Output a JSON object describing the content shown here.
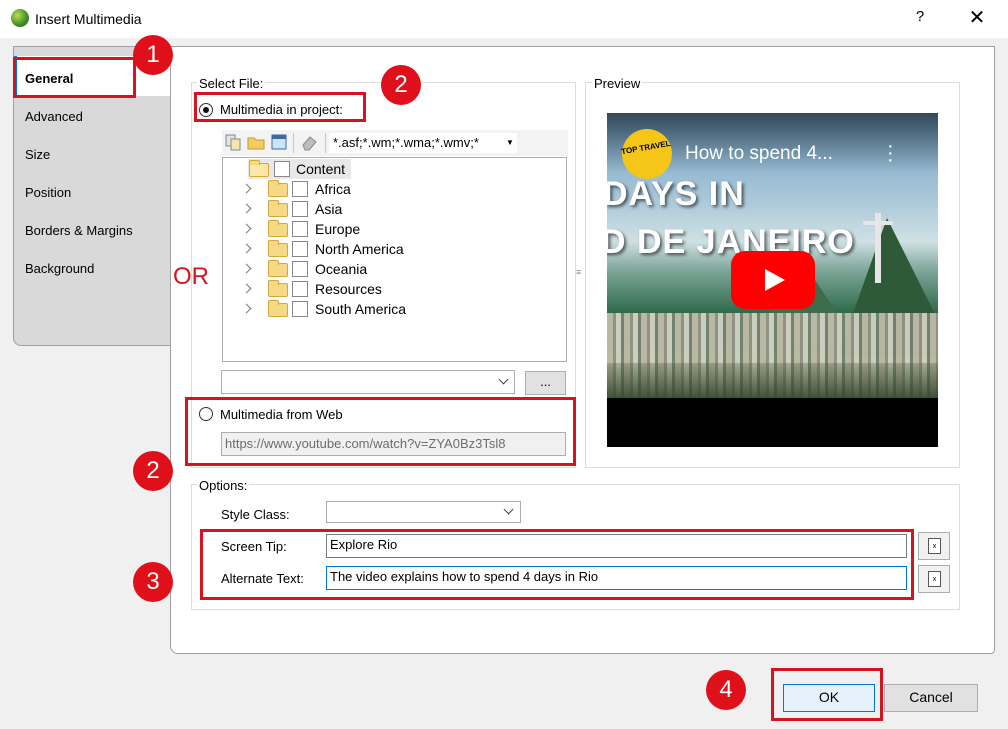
{
  "window": {
    "title": "Insert Multimedia",
    "help": "?",
    "close": "✕"
  },
  "tabs": [
    {
      "label": "General",
      "active": true
    },
    {
      "label": "Advanced"
    },
    {
      "label": "Size"
    },
    {
      "label": "Position"
    },
    {
      "label": "Borders & Margins"
    },
    {
      "label": "Background"
    }
  ],
  "select_file": {
    "group_label": "Select File:",
    "project_radio_label": "Multimedia in project:",
    "filter": "*.asf;*.wm;*.wma;*.wmv;*",
    "tree": {
      "root": "Content",
      "children": [
        "Africa",
        "Asia",
        "Europe",
        "North America",
        "Oceania",
        "Resources",
        "South America"
      ]
    },
    "path_value": "",
    "browse_label": "...",
    "web_radio_label": "Multimedia from Web",
    "web_url": "https://www.youtube.com/watch?v=ZYA0Bz3Tsl8"
  },
  "or_label": "OR",
  "preview": {
    "label": "Preview",
    "channel_logo": "TOP TRAVEL",
    "video_title": "How to spend 4...",
    "overlay_line1": "DAYS IN",
    "overlay_line2": "D DE JANEIRO"
  },
  "options": {
    "group_label": "Options:",
    "style_class_label": "Style Class:",
    "style_class_value": "",
    "screen_tip_label": "Screen Tip:",
    "screen_tip_value": "Explore Rio",
    "alt_text_label": "Alternate Text:",
    "alt_text_value": "The video explains how to spend 4 days in Rio"
  },
  "buttons": {
    "ok": "OK",
    "cancel": "Cancel"
  },
  "badges": [
    "1",
    "2",
    "2",
    "3",
    "4"
  ],
  "colors": {
    "annotation_red": "#d4141e",
    "focus_blue": "#0078d7"
  }
}
